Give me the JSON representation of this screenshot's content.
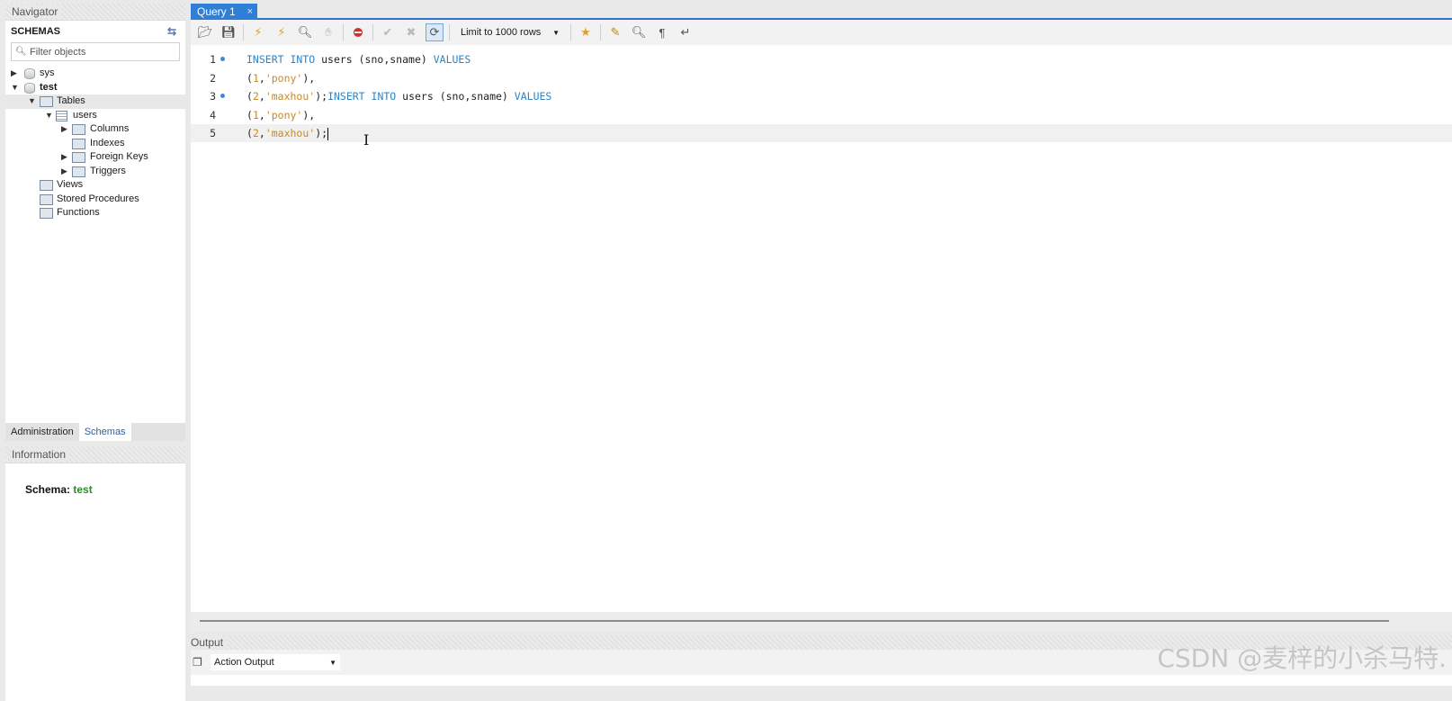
{
  "navigator": {
    "title": "Navigator",
    "schemas_label": "SCHEMAS",
    "filter_placeholder": "Filter objects",
    "tree": {
      "sys": "sys",
      "test": "test",
      "tables": "Tables",
      "users": "users",
      "columns": "Columns",
      "indexes": "Indexes",
      "foreign_keys": "Foreign Keys",
      "triggers": "Triggers",
      "views": "Views",
      "stored_procedures": "Stored Procedures",
      "functions": "Functions"
    },
    "tabs": {
      "administration": "Administration",
      "schemas": "Schemas"
    }
  },
  "information": {
    "title": "Information",
    "schema_label": "Schema:",
    "schema_value": "test"
  },
  "editor": {
    "tab_label": "Query 1",
    "tab_close": "×",
    "limit_label": "Limit to 1000 rows",
    "lines": [
      {
        "num": "1",
        "p1": "INSERT INTO",
        "p2": " users (sno,sname) ",
        "p3": "VALUES"
      },
      {
        "num": "2",
        "p1": "(",
        "p2": "1",
        "p3": ",",
        "p4": "'pony'",
        "p5": "),"
      },
      {
        "num": "3",
        "p1": "(",
        "p2": "2",
        "p3": ",",
        "p4": "'maxhou'",
        "p5": ");",
        "p6": "INSERT INTO",
        "p7": " users (sno,sname) ",
        "p8": "VALUES"
      },
      {
        "num": "4",
        "p1": "(",
        "p2": "1",
        "p3": ",",
        "p4": "'pony'",
        "p5": "),"
      },
      {
        "num": "5",
        "p1": "(",
        "p2": "2",
        "p3": ",",
        "p4": "'maxhou'",
        "p5": ");"
      }
    ]
  },
  "output": {
    "title": "Output",
    "select_value": "Action Output"
  },
  "watermark": "CSDN @麦梓的小杀马特."
}
